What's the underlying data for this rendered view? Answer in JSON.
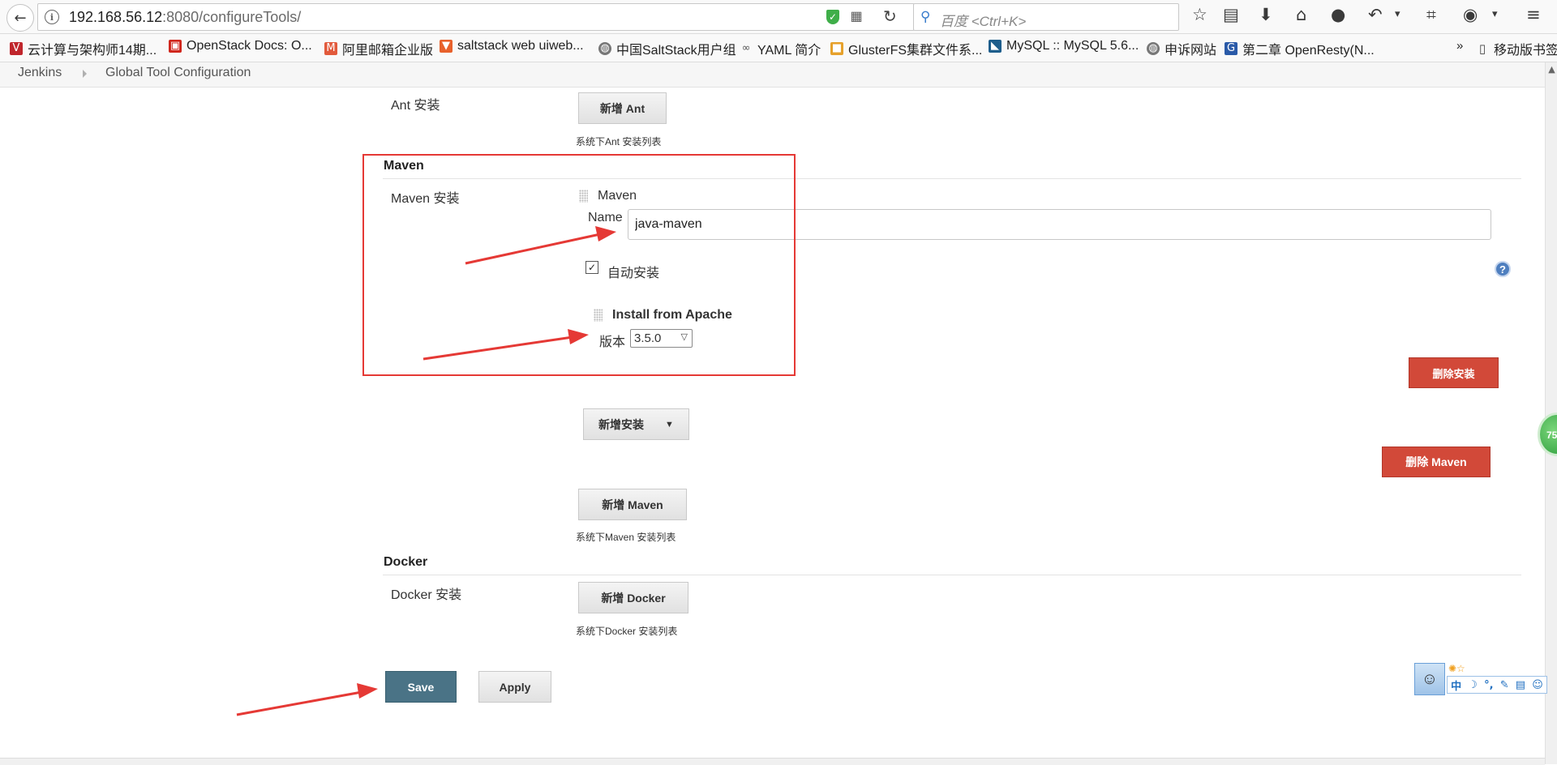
{
  "browser": {
    "url_host": "192.168.56.12",
    "url_path": ":8080/configureTools/",
    "search_placeholder": "百度 <Ctrl+K>"
  },
  "bookmarks": [
    {
      "label": "云计算与架构师14期...",
      "icon": "v-logo-icon",
      "color": "#c0262c"
    },
    {
      "label": "OpenStack Docs: O...",
      "icon": "openstack-icon",
      "color": "#d0271d"
    },
    {
      "label": "阿里邮箱企业版",
      "icon": "mail-m-icon",
      "color": "#e25a3c"
    },
    {
      "label": "saltstack web uiweb...",
      "icon": "shield-brand-icon",
      "color": "#e8612c"
    },
    {
      "label": "中国SaltStack用户组",
      "icon": "globe-icon",
      "color": "#666666"
    },
    {
      "label": "YAML 简介",
      "icon": "link-icon",
      "color": "#555555"
    },
    {
      "label": "GlusterFS集群文件系...",
      "icon": "box-icon",
      "color": "#e6a12b"
    },
    {
      "label": "MySQL :: MySQL 5.6...",
      "icon": "dolphin-icon",
      "color": "#1e5e8c"
    },
    {
      "label": "申诉网站",
      "icon": "globe-icon",
      "color": "#666666"
    },
    {
      "label": "第二章 OpenResty(N...",
      "icon": "g-logo-icon",
      "color": "#2a5aa8"
    }
  ],
  "bookmarks_more": "»",
  "mobile_bookmarks": "移动版书签",
  "breadcrumb": {
    "home": "Jenkins",
    "current": "Global Tool Configuration"
  },
  "ant": {
    "label": "Ant 安装",
    "add_button": "新增 Ant",
    "hint": "系统下Ant 安装列表"
  },
  "maven": {
    "section_title": "Maven",
    "install_label": "Maven 安装",
    "entry_title": "Maven",
    "name_label": "Name",
    "name_value": "java-maven",
    "auto_install_label": "自动安装",
    "auto_install_checked": true,
    "installer_title": "Install from Apache",
    "version_label": "版本",
    "version_value": "3.5.0",
    "delete_installer_button": "删除安装",
    "add_installer_button": "新增安装",
    "delete_maven_button": "删除 Maven",
    "add_button": "新增 Maven",
    "hint": "系统下Maven 安装列表"
  },
  "docker": {
    "section_title": "Docker",
    "install_label": "Docker 安装",
    "add_button": "新增 Docker",
    "hint": "系统下Docker 安装列表"
  },
  "actions": {
    "save": "Save",
    "apply": "Apply"
  },
  "widgets": {
    "bubble_text": "75",
    "ime_chars": [
      "中",
      "☽",
      "°,",
      "✎",
      "▤",
      "☺"
    ]
  },
  "colors": {
    "annotation_red": "#e53935",
    "delete_red": "#d24939",
    "save_blue": "#4a7386"
  }
}
